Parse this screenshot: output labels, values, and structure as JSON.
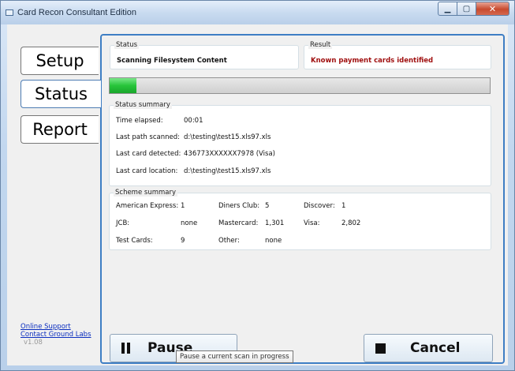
{
  "window": {
    "title": "Card Recon Consultant Edition"
  },
  "nav": {
    "setup": "Setup",
    "status": "Status",
    "report": "Report"
  },
  "links": {
    "online_support": "Online Support",
    "contact": "Contact Ground Labs",
    "version": "v1.08"
  },
  "status": {
    "legend": "Status",
    "value": "Scanning Filesystem Content"
  },
  "result": {
    "legend": "Result",
    "value": "Known payment cards identified"
  },
  "progress": {
    "percent": 7
  },
  "status_summary": {
    "legend": "Status summary",
    "rows": [
      {
        "label": "Time elapsed:",
        "value": "00:01"
      },
      {
        "label": "Last path scanned:",
        "value": "d:\\testing\\test15.xls97.xls"
      },
      {
        "label": "Last card detected:",
        "value": "436773XXXXXX7978 (Visa)"
      },
      {
        "label": "Last card location:",
        "value": "d:\\testing\\test15.xls97.xls"
      }
    ]
  },
  "scheme_summary": {
    "legend": "Scheme summary",
    "rows": [
      [
        {
          "label": "American Express:",
          "value": "1"
        },
        {
          "label": "Diners Club:",
          "value": "5"
        },
        {
          "label": "Discover:",
          "value": "1"
        }
      ],
      [
        {
          "label": "JCB:",
          "value": "none"
        },
        {
          "label": "Mastercard:",
          "value": "1,301"
        },
        {
          "label": "Visa:",
          "value": "2,802"
        }
      ],
      [
        {
          "label": "Test Cards:",
          "value": "9"
        },
        {
          "label": "Other:",
          "value": "none"
        }
      ]
    ]
  },
  "buttons": {
    "pause": "Pause",
    "cancel": "Cancel"
  },
  "tooltip": "Pause a current scan in progress",
  "colors": {
    "accent": "#3e7ec4",
    "result_text": "#a01010",
    "progress_fill": "#27c43a"
  }
}
